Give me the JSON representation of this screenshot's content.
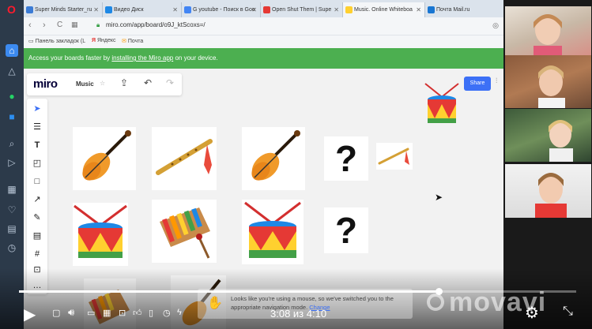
{
  "browser": {
    "tabs": [
      {
        "label": "Super Minds Starter_ru",
        "fav": "#3a7bd5"
      },
      {
        "label": "Видео Диск",
        "fav": "#1e88e5"
      },
      {
        "label": "G youtube - Поиск в Goo",
        "fav": "#4285f4"
      },
      {
        "label": "Open Shut Them | Supe",
        "fav": "#e53935"
      },
      {
        "label": "Music. Online Whiteboa",
        "fav": "#ffd02f"
      },
      {
        "label": "Почта Mail.ru",
        "fav": "#1976d2"
      }
    ],
    "url": "miro.com/app/board/o9J_ktScoxs=/",
    "bookmarks": [
      "Панель закладок (L",
      "Яндекс",
      "Почта"
    ]
  },
  "banner": {
    "prefix": "Access your boards faster by ",
    "link": "installing the Miro app",
    "suffix": " on your device."
  },
  "miro": {
    "logo": "miro",
    "board_name": "Music",
    "share_label": "Share"
  },
  "cards": {
    "question_mark": "?"
  },
  "player": {
    "timecode": "3:08 из 4:10",
    "progress_fraction": 0.753,
    "toast_text": "Looks like you're using a mouse, so we've switched you to the appropriate navigation mode.",
    "toast_link": "Change",
    "watermark": "movavi"
  },
  "icons": [
    "opera-logo-icon",
    "play-icon",
    "volume-icon",
    "settings-icon",
    "fullscreen-icon",
    "select-cursor-icon",
    "text-tool-icon",
    "sticky-note-icon",
    "shape-icon",
    "arrow-icon",
    "pen-icon",
    "comment-icon",
    "frame-icon",
    "upload-icon",
    "undo-icon",
    "redo-icon"
  ]
}
